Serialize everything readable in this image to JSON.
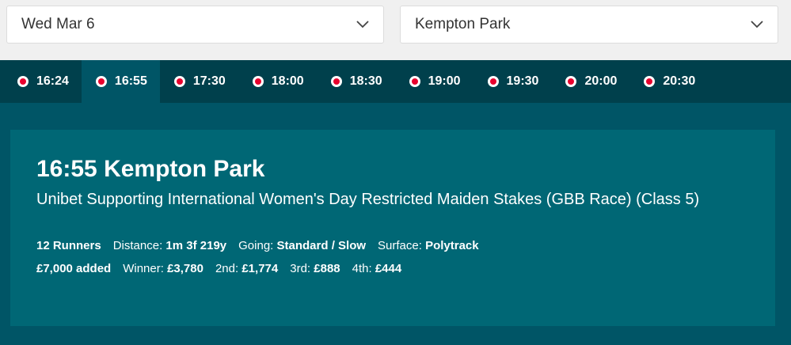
{
  "selectors": {
    "date": "Wed Mar 6",
    "course": "Kempton Park"
  },
  "race_times": [
    "16:24",
    "16:55",
    "17:30",
    "18:00",
    "18:30",
    "19:00",
    "19:30",
    "20:00",
    "20:30"
  ],
  "active_time": "16:55",
  "race": {
    "title": "16:55 Kempton Park",
    "name": "Unibet Supporting International Women's Day Restricted Maiden Stakes (GBB Race) (Class 5)",
    "runners": "12 Runners",
    "distance_label": "Distance:",
    "distance": "1m 3f 219y",
    "going_label": "Going:",
    "going": "Standard / Slow",
    "surface_label": "Surface:",
    "surface": "Polytrack",
    "prize": "£7,000 added",
    "winner_label": "Winner:",
    "winner": "£3,780",
    "second_label": "2nd:",
    "second": "£1,774",
    "third_label": "3rd:",
    "third": "£888",
    "fourth_label": "4th:",
    "fourth": "£444"
  },
  "colors": {
    "header_bg": "#00404c",
    "content_bg": "#005566",
    "card_bg": "#006775",
    "dot_red": "#e8002d"
  }
}
